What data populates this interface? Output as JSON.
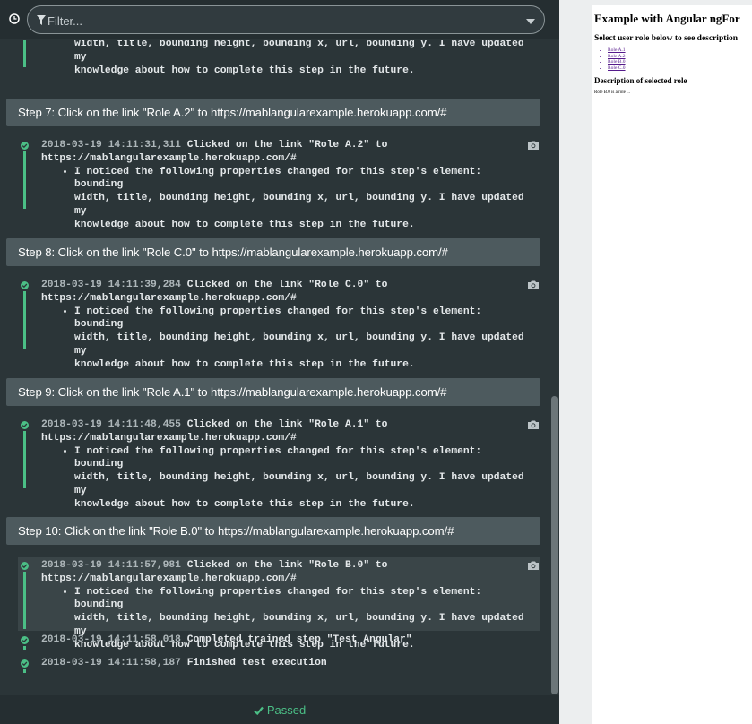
{
  "filter": {
    "placeholder": "Filter..."
  },
  "log": {
    "partial_bullet": {
      "line1": "width, title, bounding height, bounding x, url, bounding y. I have updated my",
      "line2": "knowledge about how to complete this step in the future."
    },
    "steps": [
      {
        "title": "Step 7: Click on the link \"Role A.2\" to https://mablangularexample.herokuapp.com/#",
        "timestamp": "2018-03-19 14:11:31,311",
        "message": "Clicked on the link \"Role A.2\" to",
        "url": "https://mablangularexample.herokuapp.com/#",
        "bullet1": "I noticed the following properties changed for this step's element: bounding",
        "bullet2": "width, title, bounding height, bounding x, url, bounding y. I have updated my",
        "bullet3": "knowledge about how to complete this step in the future."
      },
      {
        "title": "Step 8: Click on the link \"Role C.0\" to https://mablangularexample.herokuapp.com/#",
        "timestamp": "2018-03-19 14:11:39,284",
        "message": "Clicked on the link \"Role C.0\" to",
        "url": "https://mablangularexample.herokuapp.com/#",
        "bullet1": "I noticed the following properties changed for this step's element: bounding",
        "bullet2": "width, title, bounding height, bounding x, url, bounding y. I have updated my",
        "bullet3": "knowledge about how to complete this step in the future."
      },
      {
        "title": "Step 9: Click on the link \"Role A.1\" to https://mablangularexample.herokuapp.com/#",
        "timestamp": "2018-03-19 14:11:48,455",
        "message": "Clicked on the link \"Role A.1\" to",
        "url": "https://mablangularexample.herokuapp.com/#",
        "bullet1": "I noticed the following properties changed for this step's element: bounding",
        "bullet2": "width, title, bounding height, bounding x, url, bounding y. I have updated my",
        "bullet3": "knowledge about how to complete this step in the future."
      },
      {
        "title": "Step 10: Click on the link \"Role B.0\" to https://mablangularexample.herokuapp.com/#",
        "timestamp": "2018-03-19 14:11:57,981",
        "message": "Clicked on the link \"Role B.0\" to",
        "url": "https://mablangularexample.herokuapp.com/#",
        "bullet1": "I noticed the following properties changed for this step's element: bounding",
        "bullet2": "width, title, bounding height, bounding x, url, bounding y. I have updated my",
        "bullet3": "knowledge about how to complete this step in the future."
      }
    ],
    "completed": {
      "timestamp": "2018-03-19 14:11:58,018",
      "message": "Completed trained step \"Test Angular\""
    },
    "finished": {
      "timestamp": "2018-03-19 14:11:58,187",
      "message": "Finished test execution"
    }
  },
  "footer": {
    "status": "Passed"
  },
  "preview": {
    "title": "Example with Angular ngFor",
    "subtitle": "Select user role below to see description",
    "roles": [
      "Role A.1",
      "Role A.2",
      "Role B.0",
      "Role C.0"
    ],
    "description_heading": "Description of selected role",
    "description": "Role B.0 is a role ..."
  },
  "colors": {
    "accent_green": "#4bbf86",
    "panel_bg": "#2b3538",
    "header_bg": "#4d5a5e"
  }
}
